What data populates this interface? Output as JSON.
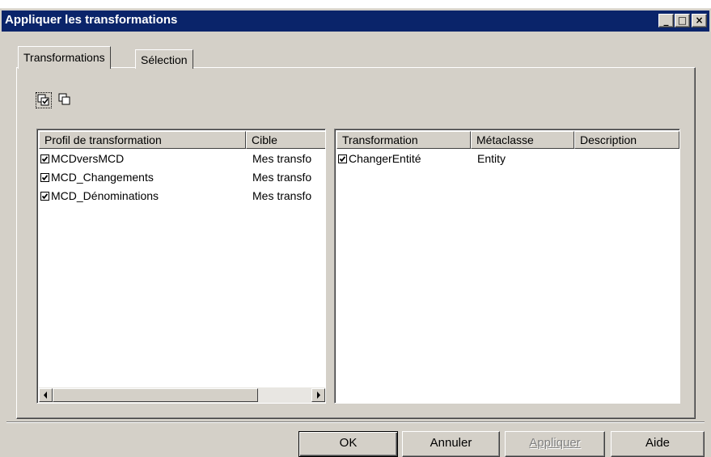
{
  "window": {
    "title": "Appliquer les transformations"
  },
  "titlebar_buttons": {
    "minimize": "_",
    "maximize": "□",
    "close": "×"
  },
  "tabs": [
    {
      "label": "Transformations",
      "active": true
    },
    {
      "label": "Sélection",
      "active": false
    }
  ],
  "toolbar": {
    "icons": [
      "select-all-icon",
      "deselect-all-icon"
    ]
  },
  "left_list": {
    "columns": [
      "Profil de transformation",
      "Cible"
    ],
    "rows": [
      {
        "checked": true,
        "name": "MCDversMCD",
        "target": "Mes transfo"
      },
      {
        "checked": true,
        "name": "MCD_Changements",
        "target": "Mes transfo"
      },
      {
        "checked": true,
        "name": "MCD_Dénominations",
        "target": "Mes transfo"
      }
    ]
  },
  "right_list": {
    "columns": [
      "Transformation",
      "Métaclasse",
      "Description"
    ],
    "rows": [
      {
        "checked": true,
        "name": "ChangerEntité",
        "metaclass": "Entity",
        "description": ""
      }
    ]
  },
  "buttons": {
    "ok": "OK",
    "cancel": "Annuler",
    "apply": "Appliquer",
    "help": "Aide"
  },
  "colors": {
    "title_bar": "#0a246a",
    "face": "#d4d0c8",
    "disabled_text": "#808080"
  }
}
